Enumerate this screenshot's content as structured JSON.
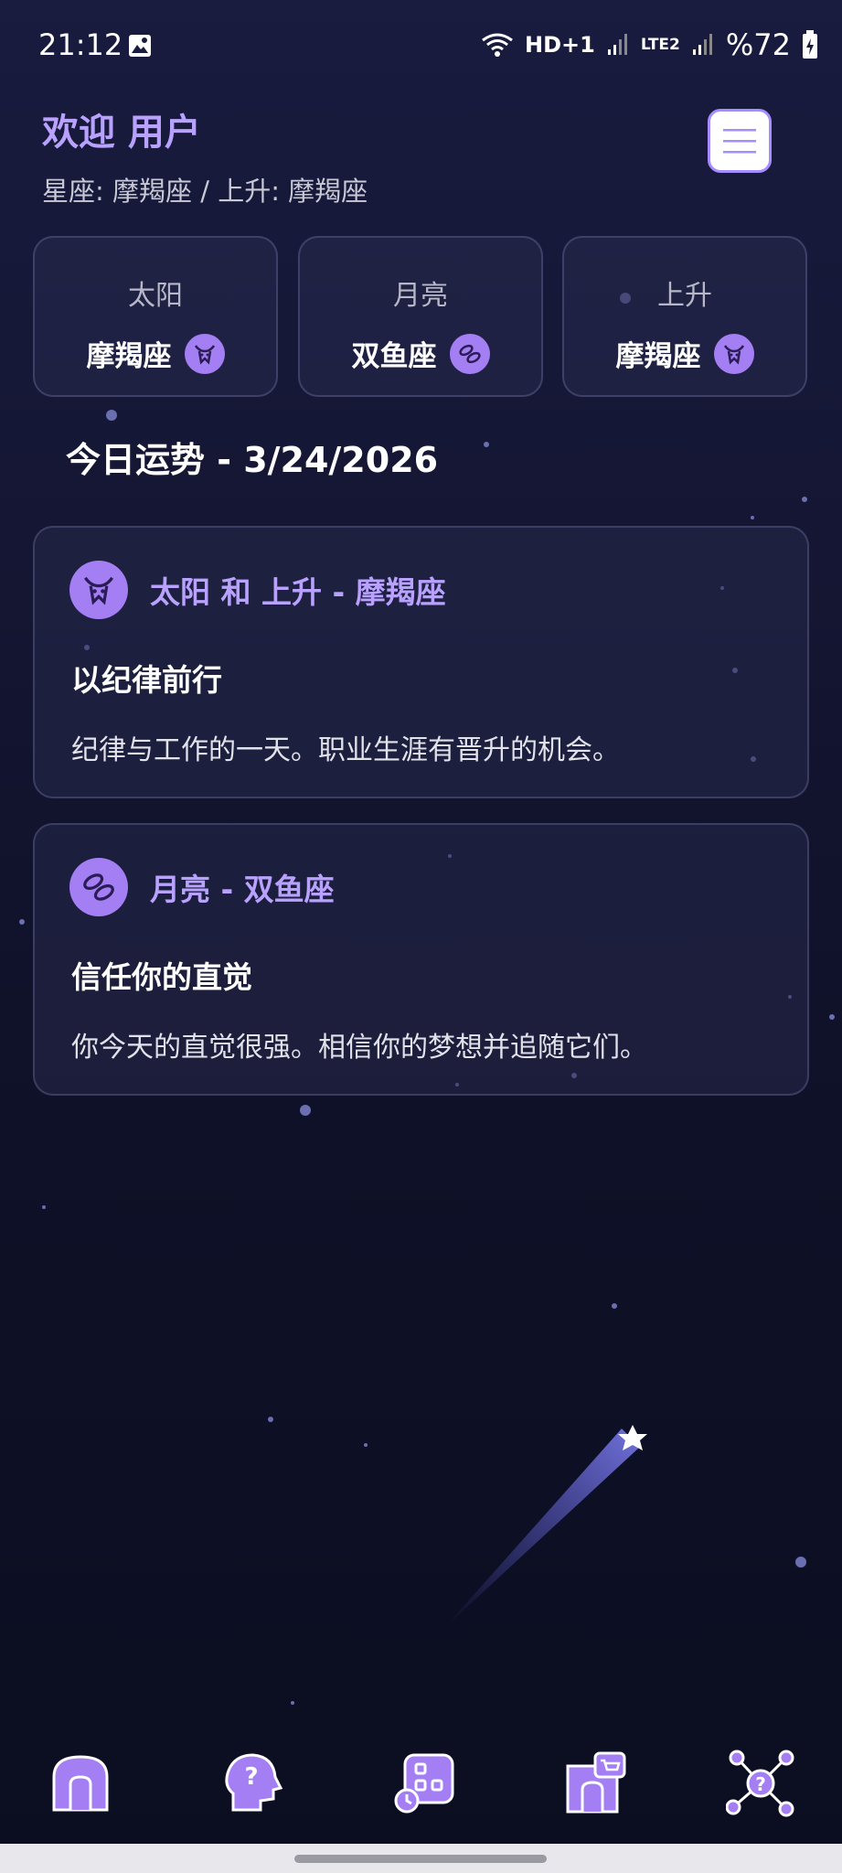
{
  "status_bar": {
    "time": "21:12",
    "network": "HD+1",
    "lte": "LTE2",
    "battery": "%72"
  },
  "header": {
    "welcome": "欢迎 用户",
    "signs_line": "星座: 摩羯座 / 上升: 摩羯座"
  },
  "sign_cards": [
    {
      "label": "太阳",
      "value": "摩羯座",
      "icon": "capricorn-icon"
    },
    {
      "label": "月亮",
      "value": "双鱼座",
      "icon": "pisces-icon"
    },
    {
      "label": "上升",
      "value": "摩羯座",
      "icon": "capricorn-icon"
    }
  ],
  "today_title": "今日运势 - 3/24/2026",
  "horoscopes": [
    {
      "title": "太阳 和 上升 - 摩羯座",
      "subtitle": "以纪律前行",
      "text": "纪律与工作的一天。职业生涯有晋升的机会。",
      "icon": "capricorn-icon"
    },
    {
      "title": "月亮 - 双鱼座",
      "subtitle": "信任你的直觉",
      "text": "你今天的直觉很强。相信你的梦想并追随它们。",
      "icon": "pisces-icon"
    }
  ],
  "nav": {
    "items": [
      "home-icon",
      "mind-question-icon",
      "apps-icon",
      "shop-icon",
      "network-question-icon"
    ]
  },
  "colors": {
    "accent": "#a47ef3",
    "accent_text": "#b9a2ff"
  }
}
